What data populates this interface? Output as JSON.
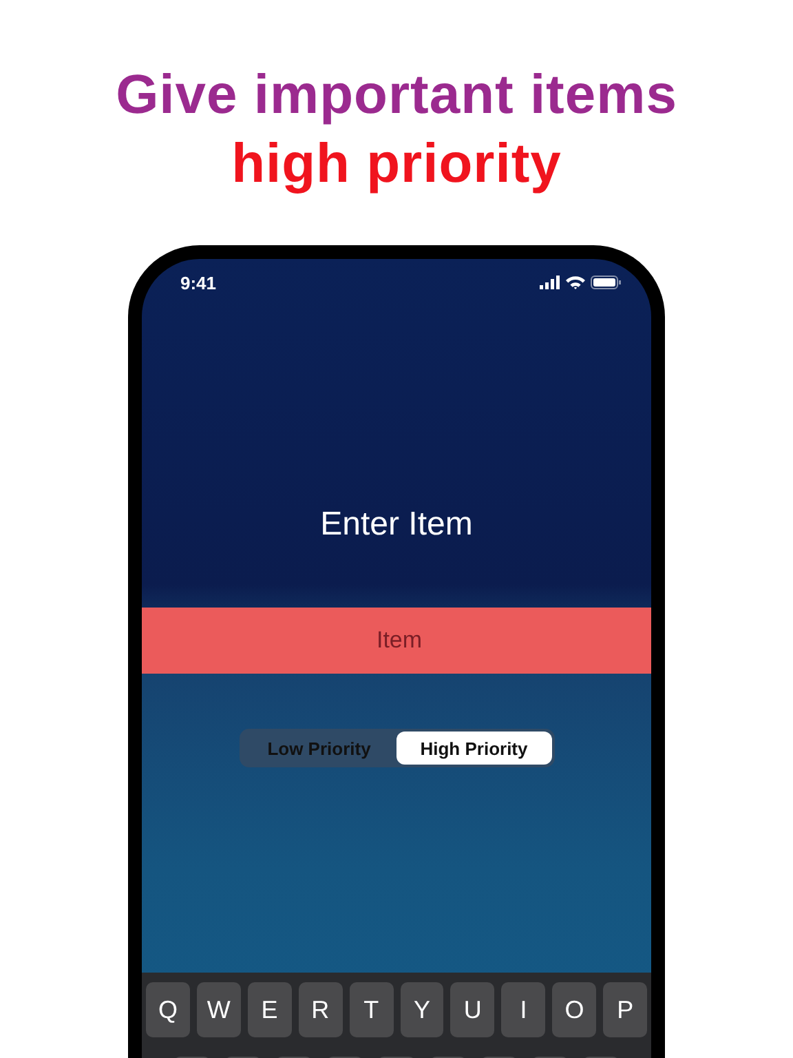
{
  "headline": [
    {
      "text": "Give important items",
      "color": "#9b2a8f"
    },
    {
      "text": "high priority",
      "color": "#f0141e"
    }
  ],
  "status_bar": {
    "time": "9:41"
  },
  "prompt": "Enter Item",
  "item_field": {
    "placeholder": "Item"
  },
  "priority": [
    {
      "label": "Low Priority",
      "selected": false
    },
    {
      "label": "High Priority",
      "selected": true
    }
  ],
  "keyboard": {
    "top_row": [
      "Q",
      "W",
      "E",
      "R",
      "T",
      "Y",
      "U",
      "I",
      "O",
      "P"
    ]
  }
}
